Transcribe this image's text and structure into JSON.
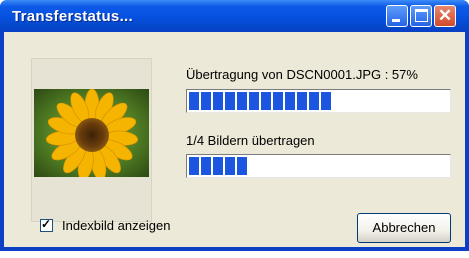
{
  "window": {
    "title": "Transferstatus...",
    "controls": {
      "minimize": "minimize-icon",
      "maximize": "maximize-icon",
      "close": "close-icon"
    }
  },
  "transfer": {
    "file_status": "Übertragung von DSCN0001.JPG : 57%",
    "file_progress": 0.57,
    "image_status": "1/4 Bildern übertragen",
    "image_progress": 0.25
  },
  "options": {
    "show_index_label": "Indexbild anzeigen",
    "show_index_checked": true
  },
  "buttons": {
    "cancel": "Abbrechen"
  },
  "colors": {
    "title_bar": "#0650df",
    "progress_block": "#1c55e0",
    "dialog_bg": "#ece9d8"
  }
}
